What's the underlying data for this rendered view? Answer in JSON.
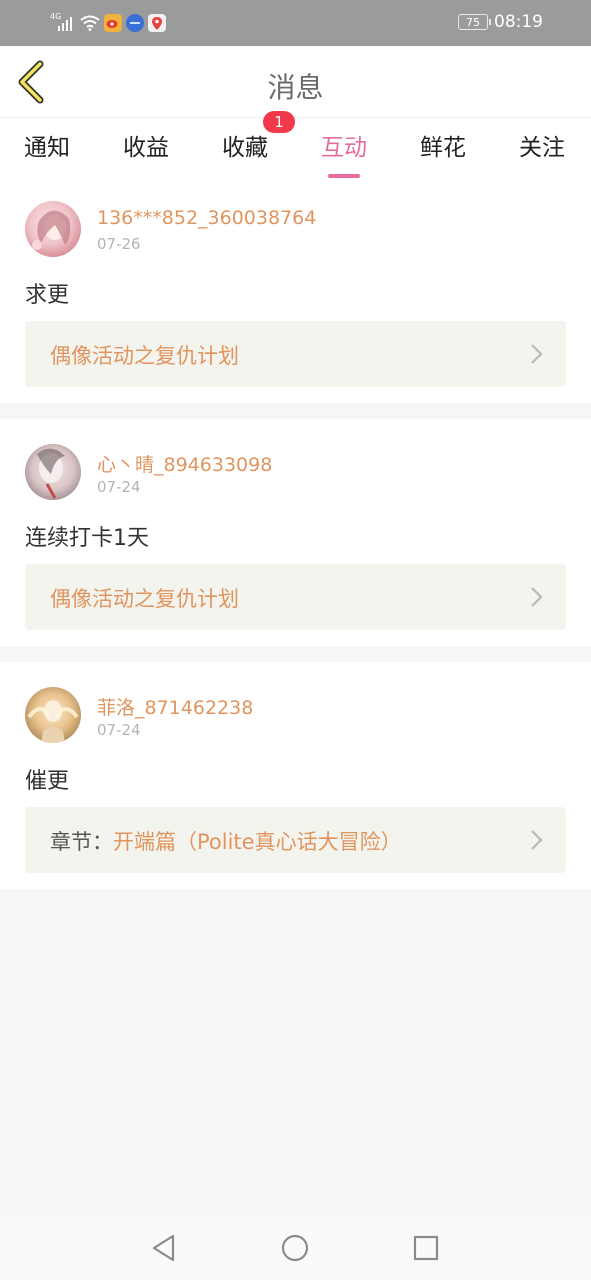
{
  "status_bar": {
    "network": "4G",
    "battery": "75",
    "time": "08:19",
    "app_icons": [
      "weibo-icon",
      "blue-app-icon",
      "map-pin-icon"
    ]
  },
  "header": {
    "title": "消息"
  },
  "tabs": [
    {
      "label": "通知"
    },
    {
      "label": "收益"
    },
    {
      "label": "收藏",
      "badge": "1"
    },
    {
      "label": "互动",
      "active": true
    },
    {
      "label": "鲜花"
    },
    {
      "label": "关注"
    }
  ],
  "messages": [
    {
      "username": "136***852_360038764",
      "date": "07-26",
      "text": "求更",
      "link_prefix": "",
      "link_text": "偶像活动之复仇计划"
    },
    {
      "username": "心丶晴_894633098",
      "date": "07-24",
      "text": "连续打卡1天",
      "link_prefix": "",
      "link_text": "偶像活动之复仇计划"
    },
    {
      "username": "菲洛_871462238",
      "date": "07-24",
      "text": "催更",
      "link_prefix": "章节：",
      "link_text": "开端篇（Polite真心话大冒险）"
    }
  ],
  "colors": {
    "accent": "#e46c9e",
    "username": "#e0955f",
    "badge": "#f2394a",
    "link_bg": "#f4f4ee"
  }
}
